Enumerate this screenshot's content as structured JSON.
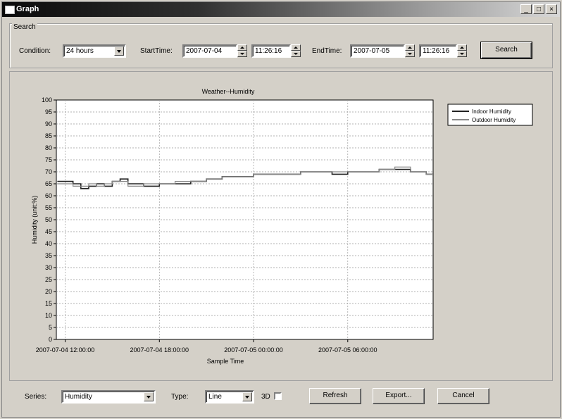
{
  "window": {
    "title": "Graph",
    "controls": [
      "_",
      "□",
      "×"
    ]
  },
  "search": {
    "group_label": "Search",
    "condition_label": "Condition:",
    "condition_value": "24 hours",
    "start_label": "StartTime:",
    "start_date": "2007-07-04",
    "start_time": "11:26:16",
    "end_label": "EndTime:",
    "end_date": "2007-07-05",
    "end_time": "11:26:16",
    "search_button": "Search"
  },
  "footer": {
    "series_label": "Series:",
    "series_value": "Humidity",
    "type_label": "Type:",
    "type_value": "Line",
    "threed_label": "3D",
    "refresh_button": "Refresh",
    "export_button": "Export...",
    "cancel_button": "Cancel"
  },
  "chart_data": {
    "type": "line",
    "title": "Weather--Humidity",
    "xlabel": "Sample Time",
    "ylabel": "Humidity (unit:%)",
    "ylim": [
      0,
      100
    ],
    "yticks": [
      0,
      5,
      10,
      15,
      20,
      25,
      30,
      35,
      40,
      45,
      50,
      55,
      60,
      65,
      70,
      75,
      80,
      85,
      90,
      95,
      100
    ],
    "xlim": [
      "2007-07-04 11:26:16",
      "2007-07-05 11:26:16"
    ],
    "xticks": [
      "2007-07-04 12:00:00",
      "2007-07-04 18:00:00",
      "2007-07-05 00:00:00",
      "2007-07-05 06:00:00"
    ],
    "grid": true,
    "legend_position": "right",
    "series": [
      {
        "name": "Indoor Humidity",
        "color": "#222222",
        "x": [
          "2007-07-04 11:30",
          "2007-07-04 12:00",
          "2007-07-04 12:30",
          "2007-07-04 13:00",
          "2007-07-04 13:30",
          "2007-07-04 14:00",
          "2007-07-04 14:30",
          "2007-07-04 15:00",
          "2007-07-04 15:30",
          "2007-07-04 16:00",
          "2007-07-04 17:00",
          "2007-07-04 18:00",
          "2007-07-04 19:00",
          "2007-07-04 20:00",
          "2007-07-04 21:00",
          "2007-07-04 22:00",
          "2007-07-05 00:00",
          "2007-07-05 01:00",
          "2007-07-05 03:00",
          "2007-07-05 05:00",
          "2007-07-05 06:00",
          "2007-07-05 07:00",
          "2007-07-05 08:00",
          "2007-07-05 09:00",
          "2007-07-05 10:00",
          "2007-07-05 11:00"
        ],
        "y": [
          66,
          66,
          65,
          63,
          64,
          65,
          64,
          66,
          67,
          65,
          64,
          65,
          65,
          66,
          67,
          68,
          69,
          69,
          70,
          69,
          70,
          70,
          71,
          71,
          70,
          69
        ]
      },
      {
        "name": "Outdoor Humidity",
        "color": "#888888",
        "x": [
          "2007-07-04 11:30",
          "2007-07-04 12:00",
          "2007-07-04 12:30",
          "2007-07-04 13:00",
          "2007-07-04 13:30",
          "2007-07-04 14:00",
          "2007-07-04 14:30",
          "2007-07-04 15:00",
          "2007-07-04 15:30",
          "2007-07-04 16:00",
          "2007-07-04 17:00",
          "2007-07-04 18:00",
          "2007-07-04 19:00",
          "2007-07-04 20:00",
          "2007-07-04 21:00",
          "2007-07-04 22:00",
          "2007-07-05 00:00",
          "2007-07-05 01:00",
          "2007-07-05 03:00",
          "2007-07-05 05:00",
          "2007-07-05 06:00",
          "2007-07-05 07:00",
          "2007-07-05 08:00",
          "2007-07-05 09:00",
          "2007-07-05 10:00",
          "2007-07-05 11:00"
        ],
        "y": [
          65,
          65,
          64,
          64,
          65,
          64,
          65,
          66,
          66,
          64,
          65,
          65,
          66,
          66,
          67,
          68,
          69,
          69,
          70,
          70,
          70,
          70,
          71,
          72,
          70,
          69
        ]
      }
    ]
  }
}
